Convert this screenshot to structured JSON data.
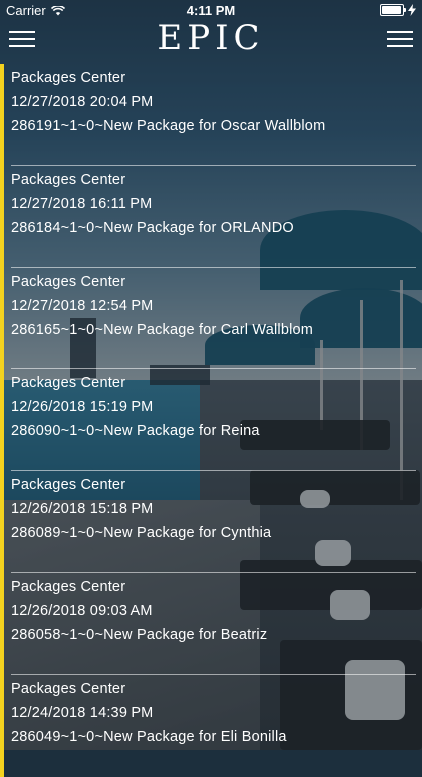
{
  "status_bar": {
    "carrier": "Carrier",
    "time": "4:11 PM"
  },
  "header": {
    "logo": "EPIC"
  },
  "accent_color": "#f4d21f",
  "packages": [
    {
      "source": "Packages Center",
      "datetime": "12/27/2018 20:04 PM",
      "message": "286191~1~0~New Package for Oscar Wallblom"
    },
    {
      "source": "Packages Center",
      "datetime": "12/27/2018 16:11 PM",
      "message": "286184~1~0~New Package for ORLANDO"
    },
    {
      "source": "Packages Center",
      "datetime": "12/27/2018 12:54 PM",
      "message": "286165~1~0~New Package for Carl Wallblom"
    },
    {
      "source": "Packages Center",
      "datetime": "12/26/2018 15:19 PM",
      "message": "286090~1~0~New Package for Reina"
    },
    {
      "source": "Packages Center",
      "datetime": "12/26/2018 15:18 PM",
      "message": "286089~1~0~New Package for Cynthia"
    },
    {
      "source": "Packages Center",
      "datetime": "12/26/2018 09:03 AM",
      "message": "286058~1~0~New Package for Beatriz"
    },
    {
      "source": "Packages Center",
      "datetime": "12/24/2018 14:39 PM",
      "message": "286049~1~0~New Package for Eli Bonilla"
    }
  ]
}
